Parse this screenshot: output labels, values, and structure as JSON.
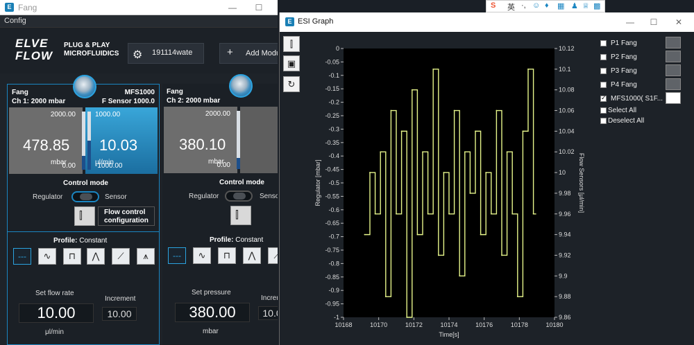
{
  "left_window": {
    "title": "Fang",
    "menu": "Config",
    "logo_main_1": "ELVE",
    "logo_main_2": "FLOW",
    "logo_sub_1": "PLUG & PLAY",
    "logo_sub_2": "MICROFLUIDICS",
    "gear_button_label": "191114wate",
    "add_button_label": "Add Modu",
    "add_button_icon": "+",
    "panel1": {
      "name": "Fang",
      "channel": "Ch 1: 2000 mbar",
      "sensor_name": "MFS1000",
      "sensor_line": "F Sensor 1000.0",
      "pressure_max": "2000.00",
      "pressure_min": "0.00",
      "pressure_value": "478.85",
      "pressure_unit": "mbar",
      "pressure_fill": 0.24,
      "flow_max": "1000.00",
      "flow_min": "-1000.00",
      "flow_value": "10.03",
      "flow_unit": "μl/min",
      "flow_fill": 0.5,
      "control_mode_title": "Control mode",
      "mode_left": "Regulator",
      "mode_right": "Sensor",
      "flow_control_label_1": "Flow control",
      "flow_control_label_2": "configuration",
      "profile_label": "Profile:",
      "profile_value": "Constant",
      "set_label": "Set flow rate",
      "increment_label": "Increment",
      "set_value": "10.00",
      "increment_value": "10.00",
      "set_unit": "μl/min"
    },
    "panel2": {
      "name": "Fang",
      "channel": "Ch 2: 2000 mbar",
      "pressure_max": "2000.00",
      "pressure_min": "0.00",
      "pressure_value": "380.10",
      "pressure_unit": "mbar",
      "pressure_fill": 0.19,
      "control_mode_title": "Control mode",
      "mode_left": "Regulator",
      "mode_right": "Senso",
      "profile_label": "Profile:",
      "profile_value": "Constant",
      "set_label": "Set pressure",
      "increment_label": "Increr",
      "set_value": "380.00",
      "increment_value": "10.0",
      "set_unit": "mbar"
    }
  },
  "right_window": {
    "title": "ESI Graph",
    "legend": {
      "items": [
        {
          "label": "P1 Fang",
          "checked": false
        },
        {
          "label": "P2 Fang",
          "checked": false
        },
        {
          "label": "P3 Fang",
          "checked": false
        },
        {
          "label": "P4 Fang",
          "checked": false
        },
        {
          "label": "MFS1000( S1F...",
          "checked": true
        }
      ],
      "select_all": "Select All",
      "deselect_all": "Deselect All"
    }
  },
  "colors": {
    "accent": "#1b86c2",
    "series": "#e6f58a"
  },
  "chart_data": {
    "type": "line",
    "title": "",
    "xlabel": "Time[s]",
    "ylabel_left": "Regulator [mbar]",
    "ylabel_right": "Flow Sensors [μl/min]",
    "xlim": [
      10168,
      10180
    ],
    "ylim_left": [
      -1,
      0
    ],
    "ylim_right": [
      9.86,
      10.12
    ],
    "x_ticks": [
      "10168",
      "10170",
      "10172",
      "10174",
      "10176",
      "10178",
      "10180"
    ],
    "y_ticks_left": [
      "0",
      "-0.05",
      "-0.1",
      "-0.15",
      "-0.2",
      "-0.25",
      "-0.3",
      "-0.35",
      "-0.4",
      "-0.45",
      "-0.5",
      "-0.55",
      "-0.6",
      "-0.65",
      "-0.7",
      "-0.75",
      "-0.8",
      "-0.85",
      "-0.9",
      "-0.95",
      "-1"
    ],
    "y_ticks_right": [
      "10.12",
      "10.1",
      "10.08",
      "10.06",
      "10.04",
      "10.02",
      "10",
      "9.98",
      "9.96",
      "9.94",
      "9.92",
      "9.9",
      "9.88",
      "9.86"
    ],
    "grid": false,
    "series": [
      {
        "name": "MFS1000( S1F...",
        "axis": "right",
        "x": [
          10169.2,
          10169.5,
          10169.8,
          10170.1,
          10170.4,
          10170.7,
          10171.0,
          10171.3,
          10171.6,
          10171.9,
          10172.2,
          10172.5,
          10172.8,
          10173.1,
          10173.4,
          10173.7,
          10174.0,
          10174.3,
          10174.6,
          10174.9,
          10175.2,
          10175.5,
          10175.8,
          10176.1,
          10176.4,
          10176.7,
          10177.0,
          10177.3,
          10177.6,
          10177.9,
          10178.2,
          10178.5,
          10178.8
        ],
        "y": [
          9.94,
          10.0,
          9.96,
          10.02,
          9.88,
          10.06,
          9.96,
          10.04,
          9.86,
          10.08,
          9.94,
          10.02,
          9.96,
          10.1,
          9.92,
          10.0,
          9.96,
          10.06,
          9.9,
          10.02,
          9.98,
          10.04,
          9.94,
          10.0,
          9.96,
          10.06,
          9.92,
          10.02,
          9.96,
          9.88,
          10.04,
          10.1,
          9.96
        ]
      }
    ]
  }
}
